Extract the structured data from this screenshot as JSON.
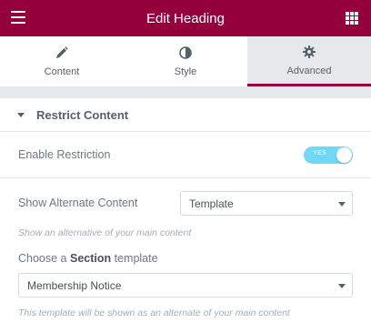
{
  "header": {
    "title": "Edit Heading"
  },
  "tabs": [
    {
      "label": "Content",
      "icon": "pencil-icon"
    },
    {
      "label": "Style",
      "icon": "contrast-icon"
    },
    {
      "label": "Advanced",
      "icon": "gear-icon"
    }
  ],
  "active_tab": "Advanced",
  "section": {
    "title": "Restrict Content",
    "expanded": true
  },
  "restriction": {
    "label": "Enable Restriction",
    "toggle_text": "YES",
    "enabled": true
  },
  "alternate": {
    "label": "Show Alternate Content",
    "value": "Template",
    "description": "Show an alternative of your main content"
  },
  "template": {
    "label_prefix": "Choose a ",
    "label_bold": "Section",
    "label_suffix": " template",
    "value": "Membership Notice",
    "description": "This template will be shown as an alternate of your main content"
  },
  "colors": {
    "brand": "#93003c",
    "toggle_on": "#71d7f7",
    "tab_active_bg": "#e6e9ec"
  }
}
